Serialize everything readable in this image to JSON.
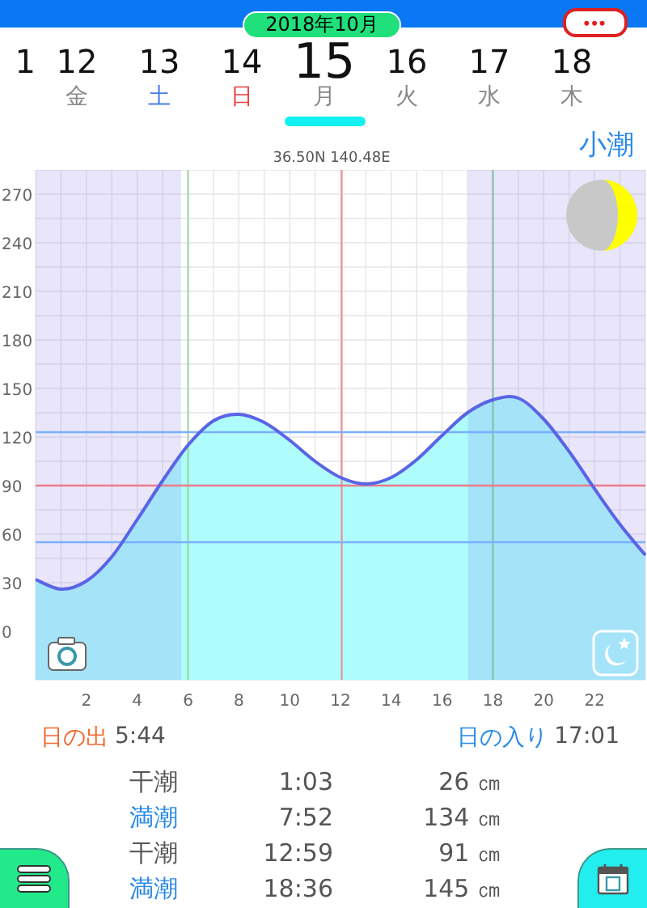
{
  "header": {
    "month": "2018年10月",
    "more": "•••"
  },
  "days": [
    {
      "day": "1",
      "selected": false
    },
    {
      "day": "12",
      "weekday": "金",
      "kind": "weekday",
      "selected": false
    },
    {
      "day": "13",
      "weekday": "土",
      "kind": "saturday",
      "selected": false
    },
    {
      "day": "14",
      "weekday": "日",
      "kind": "sunday",
      "selected": false
    },
    {
      "day": "15",
      "weekday": "月",
      "kind": "weekday",
      "selected": true
    },
    {
      "day": "16",
      "weekday": "火",
      "kind": "weekday",
      "selected": false
    },
    {
      "day": "17",
      "weekday": "水",
      "kind": "weekday",
      "selected": false
    },
    {
      "day": "18",
      "weekday": "木",
      "kind": "weekday",
      "selected": false
    }
  ],
  "chart": {
    "location": "36.50N 140.48E",
    "tide_type": "小潮",
    "chart_data": {
      "type": "area",
      "x": [
        0,
        1,
        2,
        3,
        4,
        5,
        6,
        7,
        8,
        9,
        10,
        11,
        12,
        13,
        14,
        15,
        16,
        17,
        18,
        19,
        20,
        21,
        22,
        23,
        24
      ],
      "series": [
        {
          "color": "#5a64e6",
          "values": [
            32,
            26,
            31,
            46,
            69,
            93,
            115,
            130,
            134,
            129,
            118,
            105,
            95,
            91,
            95,
            106,
            121,
            135,
            143,
            144,
            131,
            111,
            88,
            66,
            47
          ]
        }
      ],
      "xlim": [
        0,
        24
      ],
      "ylim": [
        -30,
        285
      ],
      "xticks": [
        2,
        4,
        6,
        8,
        10,
        12,
        14,
        16,
        18,
        20,
        22
      ],
      "yticks": [
        0,
        30,
        60,
        90,
        120,
        150,
        180,
        210,
        240,
        270
      ],
      "grid": true,
      "bands": [
        {
          "axis": "x",
          "from": 0,
          "to": 5.73,
          "color": "#7864e6"
        },
        {
          "axis": "x",
          "from": 17.02,
          "to": 24,
          "color": "#7864e6"
        }
      ],
      "ref_lines": [
        {
          "axis": "x",
          "value": 6,
          "color": "#9ad49a"
        },
        {
          "axis": "x",
          "value": 12.05,
          "color": "#f08a8a"
        },
        {
          "axis": "x",
          "value": 18,
          "color": "#7cc0a0"
        },
        {
          "axis": "y",
          "value": 123,
          "color": "#7ab0ff"
        },
        {
          "axis": "y",
          "value": 90,
          "color": "#f07a8a"
        },
        {
          "axis": "y",
          "value": 55,
          "color": "#7ab0ff"
        }
      ]
    }
  },
  "sun": {
    "sunrise_label": "日の出",
    "sunrise": "5:44",
    "sunset_label": "日の入り",
    "sunset": "17:01"
  },
  "tides": [
    {
      "kind": "low",
      "label": "干潮",
      "time": "1:03",
      "height": "26 ㎝"
    },
    {
      "kind": "high",
      "label": "満潮",
      "time": "7:52",
      "height": "134 ㎝"
    },
    {
      "kind": "low",
      "label": "干潮",
      "time": "12:59",
      "height": "91 ㎝"
    },
    {
      "kind": "high",
      "label": "満潮",
      "time": "18:36",
      "height": "145 ㎝"
    }
  ]
}
